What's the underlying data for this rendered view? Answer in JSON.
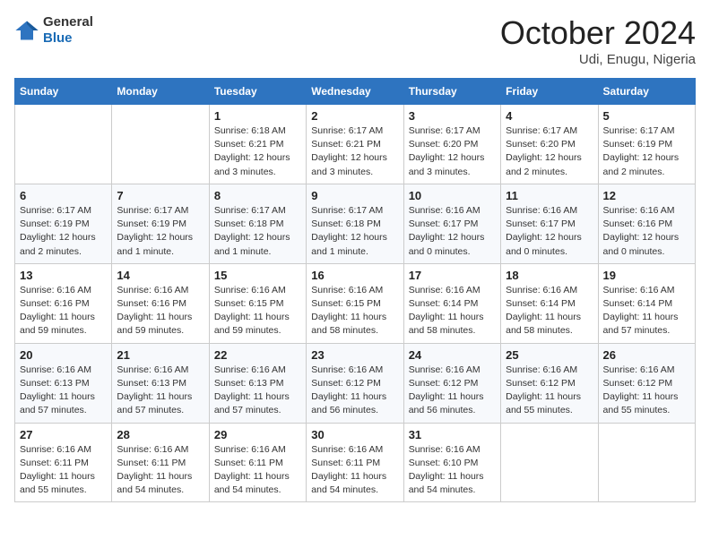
{
  "header": {
    "logo": {
      "general": "General",
      "blue": "Blue"
    },
    "title": "October 2024",
    "subtitle": "Udi, Enugu, Nigeria"
  },
  "calendar": {
    "weekdays": [
      "Sunday",
      "Monday",
      "Tuesday",
      "Wednesday",
      "Thursday",
      "Friday",
      "Saturday"
    ],
    "weeks": [
      [
        null,
        null,
        {
          "day": 1,
          "sunrise": "6:18 AM",
          "sunset": "6:21 PM",
          "daylight": "12 hours and 3 minutes."
        },
        {
          "day": 2,
          "sunrise": "6:17 AM",
          "sunset": "6:21 PM",
          "daylight": "12 hours and 3 minutes."
        },
        {
          "day": 3,
          "sunrise": "6:17 AM",
          "sunset": "6:20 PM",
          "daylight": "12 hours and 3 minutes."
        },
        {
          "day": 4,
          "sunrise": "6:17 AM",
          "sunset": "6:20 PM",
          "daylight": "12 hours and 2 minutes."
        },
        {
          "day": 5,
          "sunrise": "6:17 AM",
          "sunset": "6:19 PM",
          "daylight": "12 hours and 2 minutes."
        }
      ],
      [
        {
          "day": 6,
          "sunrise": "6:17 AM",
          "sunset": "6:19 PM",
          "daylight": "12 hours and 2 minutes."
        },
        {
          "day": 7,
          "sunrise": "6:17 AM",
          "sunset": "6:19 PM",
          "daylight": "12 hours and 1 minute."
        },
        {
          "day": 8,
          "sunrise": "6:17 AM",
          "sunset": "6:18 PM",
          "daylight": "12 hours and 1 minute."
        },
        {
          "day": 9,
          "sunrise": "6:17 AM",
          "sunset": "6:18 PM",
          "daylight": "12 hours and 1 minute."
        },
        {
          "day": 10,
          "sunrise": "6:16 AM",
          "sunset": "6:17 PM",
          "daylight": "12 hours and 0 minutes."
        },
        {
          "day": 11,
          "sunrise": "6:16 AM",
          "sunset": "6:17 PM",
          "daylight": "12 hours and 0 minutes."
        },
        {
          "day": 12,
          "sunrise": "6:16 AM",
          "sunset": "6:16 PM",
          "daylight": "12 hours and 0 minutes."
        }
      ],
      [
        {
          "day": 13,
          "sunrise": "6:16 AM",
          "sunset": "6:16 PM",
          "daylight": "11 hours and 59 minutes."
        },
        {
          "day": 14,
          "sunrise": "6:16 AM",
          "sunset": "6:16 PM",
          "daylight": "11 hours and 59 minutes."
        },
        {
          "day": 15,
          "sunrise": "6:16 AM",
          "sunset": "6:15 PM",
          "daylight": "11 hours and 59 minutes."
        },
        {
          "day": 16,
          "sunrise": "6:16 AM",
          "sunset": "6:15 PM",
          "daylight": "11 hours and 58 minutes."
        },
        {
          "day": 17,
          "sunrise": "6:16 AM",
          "sunset": "6:14 PM",
          "daylight": "11 hours and 58 minutes."
        },
        {
          "day": 18,
          "sunrise": "6:16 AM",
          "sunset": "6:14 PM",
          "daylight": "11 hours and 58 minutes."
        },
        {
          "day": 19,
          "sunrise": "6:16 AM",
          "sunset": "6:14 PM",
          "daylight": "11 hours and 57 minutes."
        }
      ],
      [
        {
          "day": 20,
          "sunrise": "6:16 AM",
          "sunset": "6:13 PM",
          "daylight": "11 hours and 57 minutes."
        },
        {
          "day": 21,
          "sunrise": "6:16 AM",
          "sunset": "6:13 PM",
          "daylight": "11 hours and 57 minutes."
        },
        {
          "day": 22,
          "sunrise": "6:16 AM",
          "sunset": "6:13 PM",
          "daylight": "11 hours and 57 minutes."
        },
        {
          "day": 23,
          "sunrise": "6:16 AM",
          "sunset": "6:12 PM",
          "daylight": "11 hours and 56 minutes."
        },
        {
          "day": 24,
          "sunrise": "6:16 AM",
          "sunset": "6:12 PM",
          "daylight": "11 hours and 56 minutes."
        },
        {
          "day": 25,
          "sunrise": "6:16 AM",
          "sunset": "6:12 PM",
          "daylight": "11 hours and 55 minutes."
        },
        {
          "day": 26,
          "sunrise": "6:16 AM",
          "sunset": "6:12 PM",
          "daylight": "11 hours and 55 minutes."
        }
      ],
      [
        {
          "day": 27,
          "sunrise": "6:16 AM",
          "sunset": "6:11 PM",
          "daylight": "11 hours and 55 minutes."
        },
        {
          "day": 28,
          "sunrise": "6:16 AM",
          "sunset": "6:11 PM",
          "daylight": "11 hours and 54 minutes."
        },
        {
          "day": 29,
          "sunrise": "6:16 AM",
          "sunset": "6:11 PM",
          "daylight": "11 hours and 54 minutes."
        },
        {
          "day": 30,
          "sunrise": "6:16 AM",
          "sunset": "6:11 PM",
          "daylight": "11 hours and 54 minutes."
        },
        {
          "day": 31,
          "sunrise": "6:16 AM",
          "sunset": "6:10 PM",
          "daylight": "11 hours and 54 minutes."
        },
        null,
        null
      ]
    ]
  },
  "labels": {
    "sunrise_prefix": "Sunrise: ",
    "sunset_prefix": "Sunset: ",
    "daylight_prefix": "Daylight: "
  }
}
